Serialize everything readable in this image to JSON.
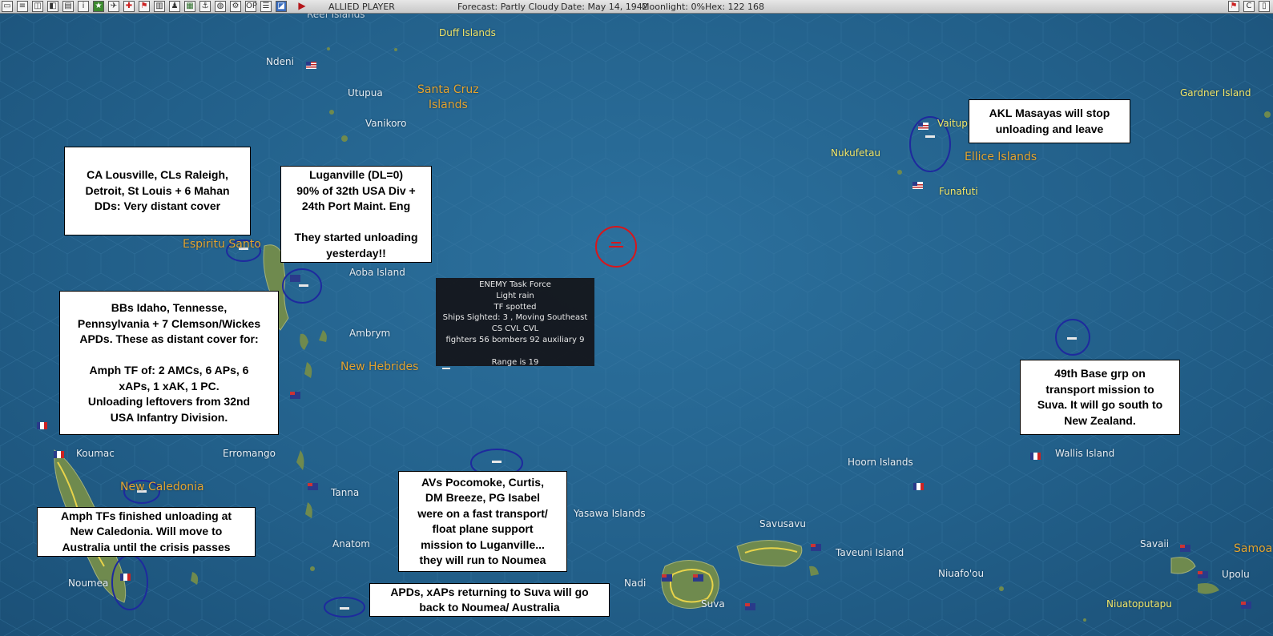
{
  "toolbar": {
    "player": "ALLIED PLAYER",
    "forecast": "Forecast: Partly Cloudy",
    "date": "Date: May 14, 1942",
    "moonlight": "Moonlight: 0%",
    "hex": "Hex: 122 168"
  },
  "region_labels": {
    "santa_cruz": "Santa Cruz\nIslands",
    "espiritu_santo": "Espiritu Santo",
    "new_hebrides": "New Hebrides",
    "new_caledonia": "New Caledonia",
    "ellice": "Ellice Islands",
    "samoa": "Samoa"
  },
  "places": {
    "duff": "Duff Islands",
    "ndeni": "Ndeni",
    "utupua": "Utupua",
    "vanikoro": "Vanikoro",
    "aoba": "Aoba Island",
    "ambrym": "Ambrym",
    "koumac": "Koumac",
    "erromango": "Erromango",
    "tanna": "Tanna",
    "anatom": "Anatom",
    "noumea": "Noumea",
    "yasawa": "Yasawa Islands",
    "nadi": "Nadi",
    "suva": "Suva",
    "savusavu": "Savusavu",
    "taveuni": "Taveuni Island",
    "niuafoou": "Niuafo'ou",
    "savaii": "Savaii",
    "upolu": "Upolu",
    "niuatoputapu": "Niuatoputapu",
    "hoorn": "Hoorn Islands",
    "wallis": "Wallis Island",
    "gardner": "Gardner Island",
    "nukufetau": "Nukufetau",
    "vaitupu": "Vaitupu",
    "funafuti": "Funafuti",
    "top_partial": "Reef Islands"
  },
  "notes": {
    "ca_cover": "CA Lousville, CLs Raleigh,\nDetroit, St Louis + 6 Mahan\nDDs: Very distant cover",
    "luganville": "Luganville (DL=0)\n90% of 32th USA Div +\n24th Port Maint. Eng\n\nThey started unloading\nyesterday!!",
    "bbs": "BBs Idaho, Tennesse,\nPennsylvania + 7 Clemson/Wickes\nAPDs. These as distant cover for:\n\nAmph TF of: 2 AMCs, 6 APs, 6\nxAPs, 1 xAK, 1 PC.\nUnloading leftovers from 32nd\nUSA Infantry Division.",
    "amph_nc": "Amph TFs finished unloading at\nNew Caledonia. Will move to\nAustralia until the crisis passes",
    "avs": "AVs Pocomoke, Curtis,\nDM Breeze, PG Isabel\nwere on a fast transport/\nfloat plane support\nmission to Luganville...\nthey will run to Noumea",
    "apds": "APDs, xAPs returning to Suva will go\nback to Noumea/ Australia",
    "akl": "AKL Masayas will stop\nunloading and leave",
    "base49": "49th Base grp on\ntransport mission to\nSuva. It will go south to\nNew Zealand."
  },
  "enemy_intel": {
    "line1": "ENEMY Task Force",
    "line2": "Light rain",
    "line3": "TF spotted",
    "line4": "Ships Sighted: 3 , Moving Southeast",
    "line5": "CS CVL CVL",
    "line6": "fighters 56  bombers 92  auxiliary 9",
    "line7": "Range is 19"
  },
  "colors": {
    "ocean": "#225f89",
    "land": "#6f8a4e",
    "region_label": "#e3a431",
    "place_label": "#e6eef4",
    "minor_label": "#f2e76a",
    "tf_circle": "#1e2a9e",
    "enemy_circle": "#d8161b"
  }
}
